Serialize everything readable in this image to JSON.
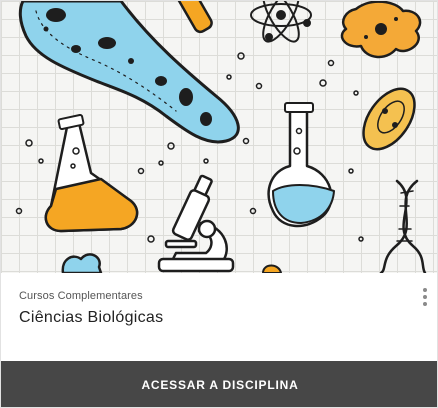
{
  "course": {
    "category": "Cursos Complementares",
    "title": "Ciências Biológicas"
  },
  "cover": {
    "illustration": "biology-lab-doodles",
    "icons": [
      "bacterium-icon",
      "atom-icon",
      "virus-icon",
      "erlenmeyer-flask-icon",
      "microscope-icon",
      "round-flask-icon",
      "dna-icon",
      "test-tube-icon",
      "paramecium-icon"
    ]
  },
  "actions": {
    "access_label": "ACESSAR A DISCIPLINA",
    "menu_icon": "kebab-menu-icon"
  },
  "colors": {
    "button_bg": "#474747",
    "bacterium_blue": "#8fd3ec",
    "flask_orange": "#f5a623",
    "virus_orange": "#f4a937"
  }
}
